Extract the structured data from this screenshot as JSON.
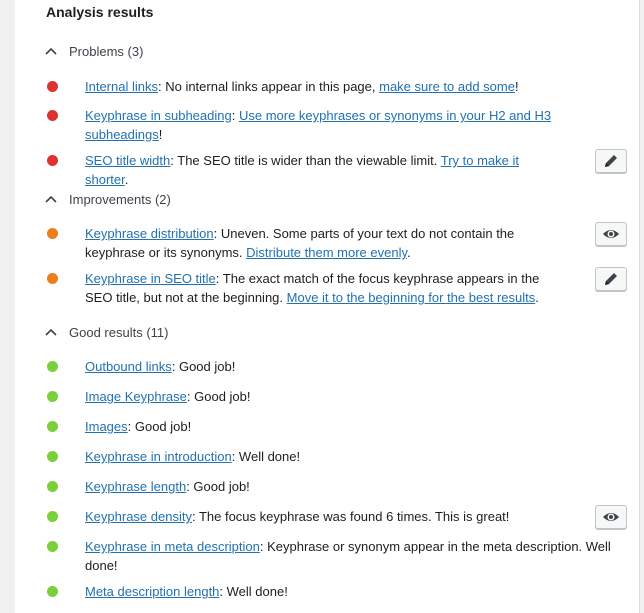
{
  "colors": {
    "problem": "#dc3232",
    "improvement": "#ee7c1b",
    "good": "#7ad03a",
    "link": "#2271b1"
  },
  "panel": {
    "title": "Analysis results"
  },
  "sections": {
    "problems": {
      "label": "Problems (3)",
      "items": [
        {
          "link": "Internal links",
          "text": ": No internal links appear in this page, ",
          "link2": "make sure to add some",
          "tail": "!"
        },
        {
          "link": "Keyphrase in subheading",
          "text": ": ",
          "link2": "Use more keyphrases or synonyms in your H2 and H3 subheadings",
          "tail": "!"
        },
        {
          "link": "SEO title width",
          "text": ": The SEO title is wider than the viewable limit. ",
          "link2": "Try to make it shorter",
          "tail": ".",
          "icon": "pencil-icon"
        }
      ]
    },
    "improvements": {
      "label": "Improvements (2)",
      "items": [
        {
          "link": "Keyphrase distribution",
          "text": ": Uneven. Some parts of your text do not contain the keyphrase or its synonyms. ",
          "link2": "Distribute them more evenly",
          "tail": ".",
          "icon": "eye-icon"
        },
        {
          "link": "Keyphrase in SEO title",
          "text": ": The exact match of the focus keyphrase appears in the SEO title, but not at the beginning. ",
          "link2": "Move it to the beginning for the best results",
          "tail": ".",
          "icon": "pencil-icon"
        }
      ]
    },
    "good": {
      "label": "Good results (11)",
      "items": [
        {
          "link": "Outbound links",
          "text": ": Good job!"
        },
        {
          "link": "Image Keyphrase",
          "text": ": Good job!"
        },
        {
          "link": "Images",
          "text": ": Good job!"
        },
        {
          "link": "Keyphrase in introduction",
          "text": ": Well done!"
        },
        {
          "link": "Keyphrase length",
          "text": ": Good job!"
        },
        {
          "link": "Keyphrase density",
          "text": ": The focus keyphrase was found 6 times. This is great!",
          "icon": "eye-icon"
        },
        {
          "link": "Keyphrase in meta description",
          "text": ": Keyphrase or synonym appear in the meta description. Well done!"
        },
        {
          "link": "Meta description length",
          "text": ": Well done!"
        }
      ]
    }
  }
}
